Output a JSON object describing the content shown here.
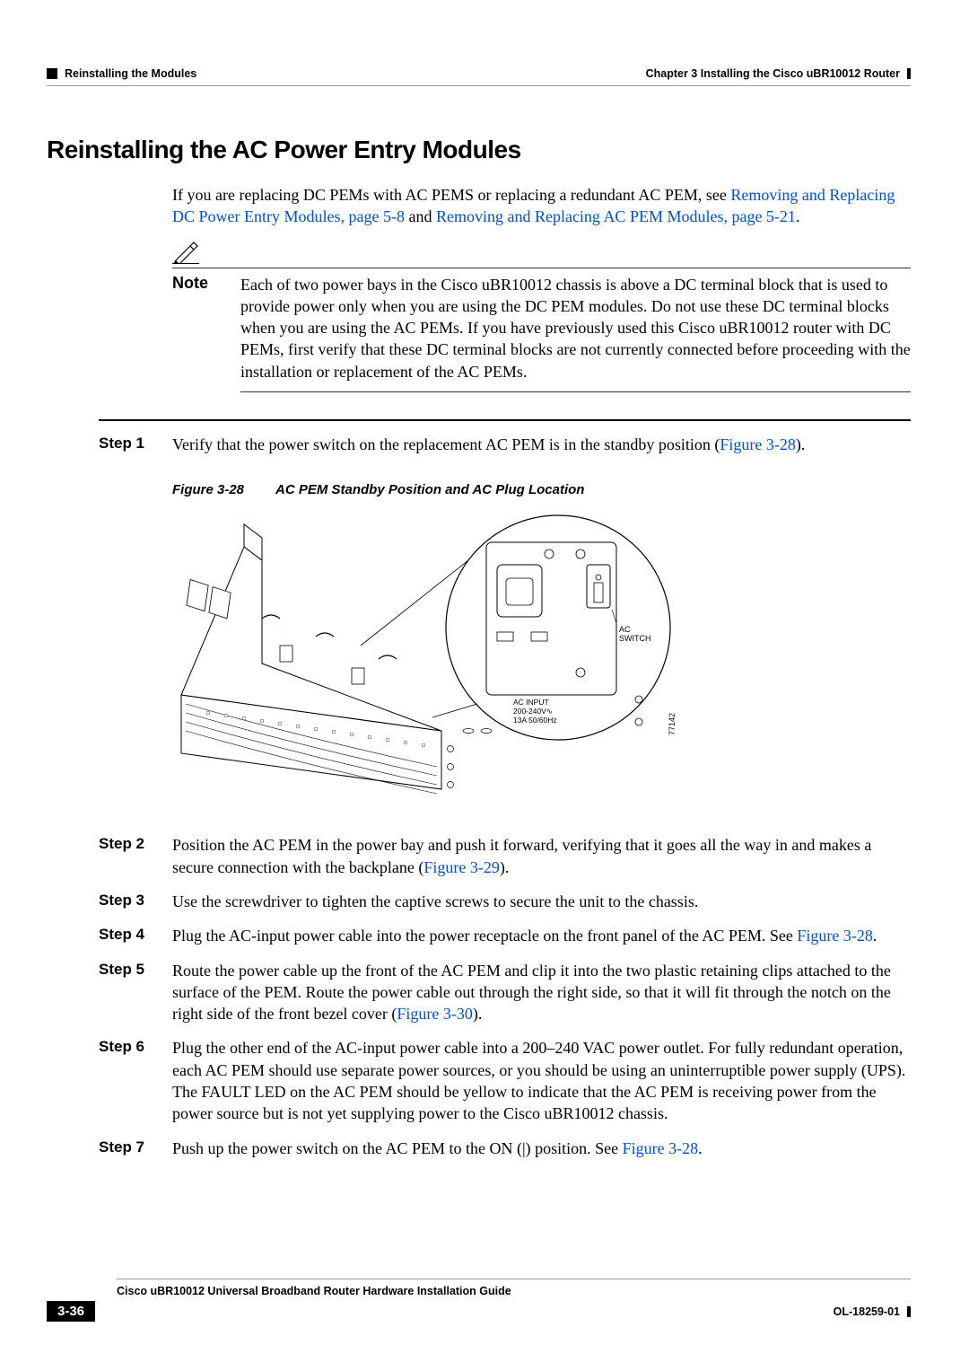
{
  "header": {
    "section": "Reinstalling the Modules",
    "chapter": "Chapter 3      Installing the Cisco uBR10012 Router"
  },
  "h1": "Reinstalling the AC Power Entry Modules",
  "intro": {
    "pre": "If you are replacing DC PEMs with AC PEMS or replacing a redundant AC PEM, see ",
    "link1": "Removing and Replacing DC Power Entry Modules, page 5-8",
    "mid": " and ",
    "link2": "Removing and Replacing AC PEM Modules, page 5-21",
    "post": "."
  },
  "note": {
    "label": "Note",
    "text": "Each of two power bays in the Cisco uBR10012 chassis is above a DC terminal block that is used to provide power only when you are using the DC PEM modules. Do not use these DC terminal blocks when you are using the AC PEMs. If you have previously used this Cisco uBR10012 router with DC PEMs, first verify that these DC terminal blocks are not currently connected before proceeding with the installation or replacement of the AC PEMs."
  },
  "steps": [
    {
      "label": "Step 1",
      "parts": [
        {
          "t": "Verify that the power switch on the replacement AC PEM is in the standby position ("
        },
        {
          "t": "Figure 3-28",
          "link": true
        },
        {
          "t": ")."
        }
      ]
    },
    {
      "label": "Step 2",
      "parts": [
        {
          "t": "Position the AC PEM in the power bay and push it forward, verifying that it goes all the way in and makes a secure connection with the backplane ("
        },
        {
          "t": "Figure 3-29",
          "link": true
        },
        {
          "t": ")."
        }
      ]
    },
    {
      "label": "Step 3",
      "parts": [
        {
          "t": "Use the screwdriver to tighten the captive screws to secure the unit to the chassis."
        }
      ]
    },
    {
      "label": "Step 4",
      "parts": [
        {
          "t": "Plug the AC-input power cable into the power receptacle on the front panel of the AC PEM. See "
        },
        {
          "t": "Figure 3-28",
          "link": true
        },
        {
          "t": "."
        }
      ]
    },
    {
      "label": "Step 5",
      "parts": [
        {
          "t": "Route the power cable up the front of the AC PEM and clip it into the two plastic retaining clips attached to the surface of the PEM. Route the power cable out through the right side, so that it will fit through the notch on the right side of the front bezel cover ("
        },
        {
          "t": "Figure 3-30",
          "link": true
        },
        {
          "t": ")."
        }
      ]
    },
    {
      "label": "Step 6",
      "parts": [
        {
          "t": "Plug the other end of the AC-input power cable into a 200–240 VAC power outlet. For fully redundant operation, each AC PEM should use separate power sources, or you should be using an uninterruptible power supply (UPS). The FAULT LED on the AC PEM should be yellow to indicate that the AC PEM is receiving power from the power source but is not yet supplying power to the Cisco uBR10012 chassis."
        }
      ]
    },
    {
      "label": "Step 7",
      "parts": [
        {
          "t": "Push up the power switch on the AC PEM to the ON (|) position. See "
        },
        {
          "t": "Figure 3-28",
          "link": true
        },
        {
          "t": "."
        }
      ]
    }
  ],
  "figure": {
    "num": "Figure 3-28",
    "title": "AC PEM Standby Position and AC Plug Location",
    "labels": {
      "switch": "AC SWITCH",
      "input1": "AC INPUT",
      "input2": "200-240V",
      "input3": "13A 50/60Hz",
      "id": "77142"
    }
  },
  "footer": {
    "title": "Cisco uBR10012 Universal Broadband Router Hardware Installation Guide",
    "page": "3-36",
    "docnum": "OL-18259-01"
  }
}
